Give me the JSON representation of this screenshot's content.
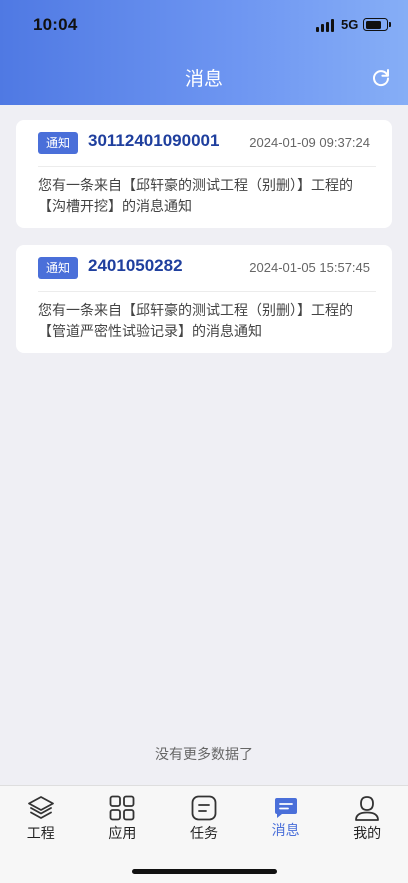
{
  "status_bar": {
    "time": "10:04",
    "network": "5G"
  },
  "header": {
    "title": "消息"
  },
  "messages": [
    {
      "tag": "通知",
      "number": "30112401090001",
      "timestamp": "2024-01-09 09:37:24",
      "content": "您有一条来自【邱轩豪的测试工程（别删）】工程的【沟槽开挖】的消息通知"
    },
    {
      "tag": "通知",
      "number": "2401050282",
      "timestamp": "2024-01-05 15:57:45",
      "content": "您有一条来自【邱轩豪的测试工程（别删）】工程的【管道严密性试验记录】的消息通知"
    }
  ],
  "list_footer": "没有更多数据了",
  "tabbar": {
    "items": [
      {
        "label": "工程",
        "icon": "layers-icon"
      },
      {
        "label": "应用",
        "icon": "grid-icon"
      },
      {
        "label": "任务",
        "icon": "task-icon"
      },
      {
        "label": "消息",
        "icon": "message-icon"
      },
      {
        "label": "我的",
        "icon": "user-icon"
      }
    ],
    "active_index": 3
  },
  "colors": {
    "accent": "#4a6fd9",
    "number": "#1f3f9e",
    "background": "#efeff4"
  }
}
